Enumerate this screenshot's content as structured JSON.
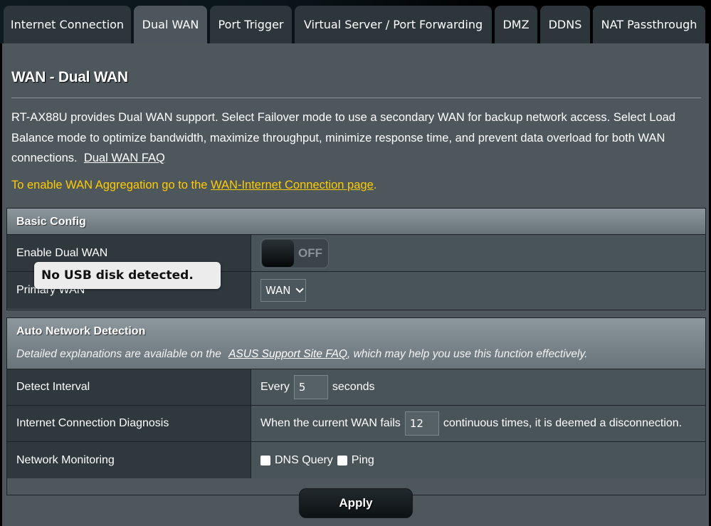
{
  "tabs": [
    {
      "label": "Internet Connection",
      "active": false
    },
    {
      "label": "Dual WAN",
      "active": true
    },
    {
      "label": "Port Trigger",
      "active": false
    },
    {
      "label": "Virtual Server / Port Forwarding",
      "active": false
    },
    {
      "label": "DMZ",
      "active": false
    },
    {
      "label": "DDNS",
      "active": false
    },
    {
      "label": "NAT Passthrough",
      "active": false
    }
  ],
  "page": {
    "title": "WAN - Dual WAN",
    "description": "RT-AX88U provides Dual WAN support. Select Failover mode to use a secondary WAN for backup network access. Select Load Balance mode to optimize bandwidth, maximize throughput, minimize response time, and prevent data overload for both WAN connections.",
    "faq_link": "Dual WAN FAQ",
    "notice_prefix": "To enable WAN Aggregation go to the ",
    "notice_link": "WAN-Internet Connection page",
    "notice_suffix": ".",
    "notice_color": "#ffcc00"
  },
  "basic_config": {
    "header": "Basic Config",
    "enable_dual_wan": {
      "label": "Enable Dual WAN",
      "state": "OFF"
    },
    "primary_wan": {
      "label": "Primary WAN",
      "value": "WAN"
    }
  },
  "tooltip": "No USB disk detected.",
  "auto_detection": {
    "header": "Auto Network Detection",
    "sub_prefix": "Detailed explanations are available on the ",
    "sub_link": "ASUS Support Site FAQ",
    "sub_suffix": ", which may help you use this function effectively.",
    "detect_interval": {
      "label": "Detect Interval",
      "prefix": "Every",
      "value": "5",
      "suffix": "seconds"
    },
    "diagnosis": {
      "label": "Internet Connection Diagnosis",
      "prefix": "When the current WAN fails",
      "value": "12",
      "suffix": "continuous times, it is deemed a disconnection."
    },
    "monitoring": {
      "label": "Network Monitoring",
      "dns_query": "DNS Query",
      "ping": "Ping",
      "dns_checked": false,
      "ping_checked": false
    }
  },
  "apply_label": "Apply"
}
